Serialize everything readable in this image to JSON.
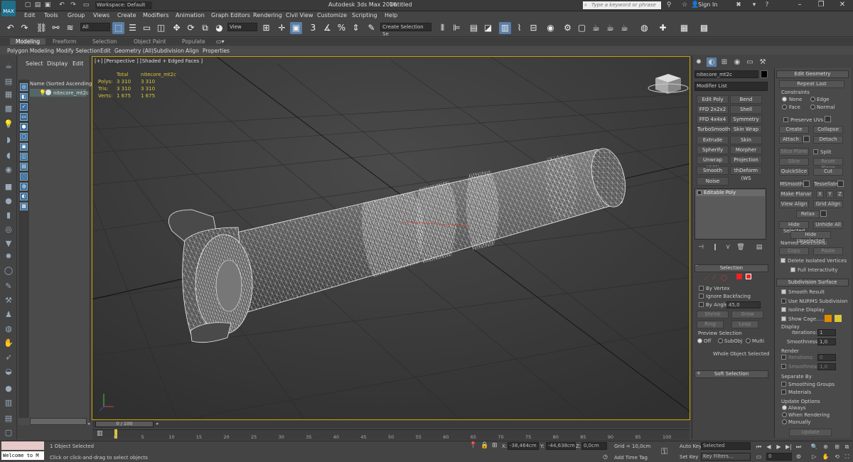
{
  "titlebar": {
    "app_title": "Autodesk 3ds Max 2016",
    "document": "Untitled",
    "workspace": "Workspace: Default",
    "search_placeholder": "Type a keyword or phrase",
    "signin": "Sign In",
    "app_icon": "MAX"
  },
  "menu": [
    "Edit",
    "Tools",
    "Group",
    "Views",
    "Create",
    "Modifiers",
    "Animation",
    "Graph Editors",
    "Rendering",
    "Civil View",
    "Customize",
    "Scripting",
    "Help"
  ],
  "toolbar": {
    "filter": "All",
    "view": "View",
    "selection_set": "Create Selection Se"
  },
  "ribbon": {
    "tabs": [
      "Modeling",
      "Freeform",
      "Selection",
      "Object Paint",
      "Populate"
    ],
    "active_tab": "Modeling",
    "subtabs": [
      "Polygon Modeling",
      "Modify Selection",
      "Edit",
      "Geometry (All)",
      "Subdivision",
      "Align",
      "Properties"
    ]
  },
  "explorer": {
    "tabs": [
      "Select",
      "Display",
      "Edit"
    ],
    "header": "Name (Sorted Ascending)",
    "item": "nitecore_mt2c",
    "frame": "0 / 100"
  },
  "viewport": {
    "label": "[+] [Perspective ] [Shaded + Edged Faces ]",
    "stats": {
      "col_total": "Total",
      "col_obj": "nitecore_mt2c",
      "rows": [
        {
          "label": "Polys:",
          "total": "3 310",
          "obj": "3 310"
        },
        {
          "label": "Tris:",
          "total": "3 310",
          "obj": "3 310"
        },
        {
          "label": "Verts:",
          "total": "1 675",
          "obj": "1 675"
        }
      ]
    }
  },
  "command_panel": {
    "object_name": "nitecore_mt2c",
    "modifier_list": "Modifier List",
    "modifiers": [
      "Edit Poly",
      "Bend",
      "FFD 2x2x2",
      "Shell",
      "FFD 4x4x4",
      "Symmetry",
      "TurboSmooth",
      "Skin Wrap",
      "Extrude",
      "Skin",
      "Spherify",
      "Morpher",
      "Unwrap UVW",
      "Projection",
      "Smooth",
      "thDeform (WS",
      "Noise"
    ],
    "stack_item": "Editable Poly",
    "selection": {
      "title": "Selection",
      "by_vertex": "By Vertex",
      "ignore_backfacing": "Ignore Backfacing",
      "by_angle": "By Angle:",
      "angle": "45,0",
      "shrink": "Shrink",
      "grow": "Grow",
      "ring": "Ring",
      "loop": "Loop",
      "preview": "Preview Selection",
      "off": "Off",
      "subobj": "SubObj",
      "multi": "Multi",
      "status": "Whole Object Selected"
    },
    "soft_selection": "Soft Selection"
  },
  "edit_geometry": {
    "title": "Edit Geometry",
    "repeat_last": "Repeat Last",
    "constraints": "Constraints",
    "c_none": "None",
    "c_edge": "Edge",
    "c_face": "Face",
    "c_normal": "Normal",
    "preserve_uvs": "Preserve UVs",
    "create": "Create",
    "collapse": "Collapse",
    "attach": "Attach",
    "detach": "Detach",
    "slice_plane": "Slice Plane",
    "split": "Split",
    "slice": "Slice",
    "reset_plane": "Reset Plane",
    "quickslice": "QuickSlice",
    "cut": "Cut",
    "msmooth": "MSmooth",
    "tessellate": "Tessellate",
    "make_planar": "Make Planar",
    "x": "X",
    "y": "Y",
    "z": "Z",
    "view_align": "View Align",
    "grid_align": "Grid Align",
    "relax": "Relax",
    "hide_selected": "Hide Selected",
    "unhide_all": "Unhide All",
    "hide_unselected": "Hide Unselected",
    "named_selections": "Named Selections:",
    "copy": "Copy",
    "paste": "Paste",
    "delete_isolated": "Delete Isolated Vertices",
    "full_interactivity": "Full Interactivity"
  },
  "subdivision": {
    "title": "Subdivision Surface",
    "smooth_result": "Smooth Result",
    "use_nurms": "Use NURMS Subdivision",
    "isoline": "Isoline Display",
    "show_cage": "Show Cage......",
    "cage_color1": "#e08a00",
    "cage_color2": "#d8c83a",
    "display": "Display",
    "iterations": "Iterations:",
    "iterations_val": "1",
    "smoothness": "Smoothness:",
    "smoothness_val": "1,0",
    "render": "Render",
    "r_iterations_val": "0",
    "r_smoothness_val": "1,0",
    "separate_by": "Separate By",
    "smoothing_groups": "Smoothing Groups",
    "materials": "Materials",
    "update_options": "Update Options",
    "always": "Always",
    "when_rendering": "When Rendering",
    "manually": "Manually",
    "update": "Update"
  },
  "timeline": {
    "ticks": [
      "0",
      "5",
      "10",
      "15",
      "20",
      "25",
      "30",
      "35",
      "40",
      "45",
      "50",
      "55",
      "60",
      "65",
      "70",
      "75",
      "80",
      "85",
      "90",
      "95",
      "100"
    ]
  },
  "status": {
    "maxscript": "Welcome to M",
    "selected": "1 Object Selected",
    "prompt": "Click or click-and-drag to select objects",
    "x_label": "X:",
    "x": "-38,464cm",
    "y_label": "Y:",
    "y": "-44,638cm",
    "z_label": "Z:",
    "z": "0,0cm",
    "grid": "Grid = 10,0cm",
    "add_time_tag": "Add Time Tag",
    "auto_key": "Auto Key",
    "set_key": "Set Key",
    "selected_dd": "Selected",
    "key_filters": "Key Filters...",
    "frame": "0"
  },
  "colors": {
    "viewport_border": "#c8a000",
    "stats_text": "#d8c43a"
  }
}
